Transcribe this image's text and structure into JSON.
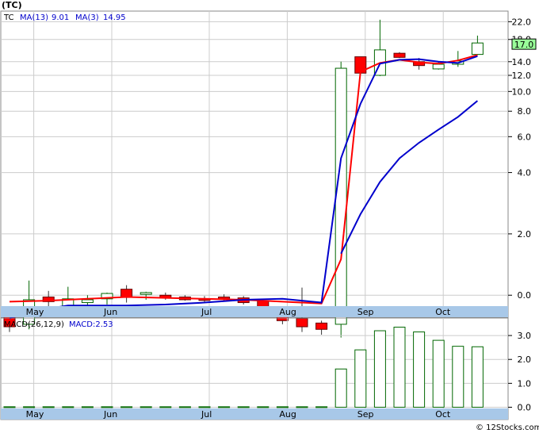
{
  "header": {
    "title": "(TC)",
    "ticker": "TC",
    "ma13_label": "MA(13)",
    "ma13_value": "9.01",
    "ma3_label": "MA(3)",
    "ma3_value": "14.95",
    "macd_label": "MACD(26,12,9)",
    "macd_value_label": "MACD:2.53",
    "watermark": "© 12Stocks.com"
  },
  "colors": {
    "up": "#006600",
    "down": "#ff0000",
    "ma13": "#ff0000",
    "ma3": "#0000cc",
    "axis_bg": "#a8c8e8",
    "grid": "#cccccc",
    "last_price_box": "#99ff99"
  },
  "chart_data": [
    {
      "type": "candlestick",
      "title": "(TC)",
      "yscale": "log",
      "ylim": [
        0.9,
        23.5
      ],
      "price_ticks": [
        {
          "value": 22.0,
          "label": "22.0"
        },
        {
          "value": 18.0,
          "label": "18.0"
        },
        {
          "value": 14.0,
          "label": "14.0"
        },
        {
          "value": 12.0,
          "label": "12.0"
        },
        {
          "value": 10.0,
          "label": "10.0"
        },
        {
          "value": 8.0,
          "label": "8.0"
        },
        {
          "value": 6.0,
          "label": "6.0"
        },
        {
          "value": 4.0,
          "label": "4.0"
        },
        {
          "value": 2.0,
          "label": "2.0"
        },
        {
          "value": 1.0,
          "label": "0.0"
        }
      ],
      "last_price": {
        "value": 17.0,
        "label": "17.0"
      },
      "x_labels": [
        {
          "week": 1,
          "label": "May"
        },
        {
          "week": 5,
          "label": "Jun"
        },
        {
          "week": 10,
          "label": "Jul"
        },
        {
          "week": 14,
          "label": "Aug"
        },
        {
          "week": 18,
          "label": "Sep"
        },
        {
          "week": 22,
          "label": "Oct"
        }
      ],
      "weeks": 24,
      "candles": [
        {
          "week": 0,
          "open": 0.8,
          "high": 0.81,
          "low": 0.66,
          "close": 0.7
        },
        {
          "week": 1,
          "open": 0.72,
          "high": 1.18,
          "low": 0.68,
          "close": 0.95
        },
        {
          "week": 2,
          "open": 0.98,
          "high": 1.05,
          "low": 0.8,
          "close": 0.93
        },
        {
          "week": 3,
          "open": 0.88,
          "high": 1.1,
          "low": 0.8,
          "close": 0.96
        },
        {
          "week": 4,
          "open": 0.92,
          "high": 1.0,
          "low": 0.86,
          "close": 0.95
        },
        {
          "week": 5,
          "open": 0.96,
          "high": 1.03,
          "low": 0.9,
          "close": 1.02
        },
        {
          "week": 6,
          "open": 1.07,
          "high": 1.12,
          "low": 0.92,
          "close": 0.98
        },
        {
          "week": 7,
          "open": 1.01,
          "high": 1.04,
          "low": 0.95,
          "close": 1.03
        },
        {
          "week": 8,
          "open": 1.0,
          "high": 1.03,
          "low": 0.95,
          "close": 0.97
        },
        {
          "week": 9,
          "open": 0.98,
          "high": 1.0,
          "low": 0.94,
          "close": 0.95
        },
        {
          "week": 10,
          "open": 0.96,
          "high": 0.99,
          "low": 0.92,
          "close": 0.95
        },
        {
          "week": 11,
          "open": 0.98,
          "high": 1.01,
          "low": 0.93,
          "close": 0.96
        },
        {
          "week": 12,
          "open": 0.97,
          "high": 0.99,
          "low": 0.9,
          "close": 0.92
        },
        {
          "week": 13,
          "open": 0.94,
          "high": 0.95,
          "low": 0.79,
          "close": 0.81
        },
        {
          "week": 14,
          "open": 0.84,
          "high": 0.87,
          "low": 0.72,
          "close": 0.75
        },
        {
          "week": 15,
          "open": 0.77,
          "high": 1.09,
          "low": 0.66,
          "close": 0.7
        },
        {
          "week": 16,
          "open": 0.73,
          "high": 0.75,
          "low": 0.64,
          "close": 0.68
        },
        {
          "week": 17,
          "open": 0.72,
          "high": 14.0,
          "low": 0.62,
          "close": 13.0
        },
        {
          "week": 18,
          "open": 14.8,
          "high": 14.8,
          "low": 12.3,
          "close": 12.3
        },
        {
          "week": 19,
          "open": 12.0,
          "high": 22.5,
          "low": 11.9,
          "close": 16.0
        },
        {
          "week": 20,
          "open": 15.4,
          "high": 15.6,
          "low": 14.6,
          "close": 14.7
        },
        {
          "week": 21,
          "open": 14.0,
          "high": 14.6,
          "low": 12.8,
          "close": 13.4
        },
        {
          "week": 22,
          "open": 12.9,
          "high": 14.1,
          "low": 12.8,
          "close": 13.6
        },
        {
          "week": 23,
          "open": 13.6,
          "high": 15.8,
          "low": 13.2,
          "close": 14.1
        },
        {
          "week": 24,
          "open": 15.2,
          "high": 18.8,
          "low": 15.1,
          "close": 17.3
        }
      ],
      "series": [
        {
          "name": "MA(13)",
          "color": "#ff0000",
          "points": [
            {
              "week": 0,
              "value": 0.93
            },
            {
              "week": 2,
              "value": 0.94
            },
            {
              "week": 4,
              "value": 0.96
            },
            {
              "week": 6,
              "value": 0.98
            },
            {
              "week": 8,
              "value": 0.97
            },
            {
              "week": 10,
              "value": 0.96
            },
            {
              "week": 12,
              "value": 0.95
            },
            {
              "week": 14,
              "value": 0.93
            },
            {
              "week": 16,
              "value": 0.91
            },
            {
              "week": 17,
              "value": 1.5
            },
            {
              "week": 18,
              "value": 12.5
            },
            {
              "week": 19,
              "value": 13.8
            },
            {
              "week": 20,
              "value": 14.3
            },
            {
              "week": 21,
              "value": 13.9
            },
            {
              "week": 22,
              "value": 13.7
            },
            {
              "week": 23,
              "value": 14.2
            },
            {
              "week": 24,
              "value": 15.1
            }
          ]
        },
        {
          "name": "MA(3)",
          "color": "#0000cc",
          "points": [
            {
              "week": 0,
              "value": 0.77
            },
            {
              "week": 1,
              "value": 0.83
            },
            {
              "week": 2,
              "value": 0.86
            },
            {
              "week": 3,
              "value": 0.89
            },
            {
              "week": 4,
              "value": 0.89
            },
            {
              "week": 6,
              "value": 0.89
            },
            {
              "week": 8,
              "value": 0.9
            },
            {
              "week": 10,
              "value": 0.92
            },
            {
              "week": 12,
              "value": 0.95
            },
            {
              "week": 14,
              "value": 0.96
            },
            {
              "week": 16,
              "value": 0.92
            },
            {
              "week": 17,
              "value": 4.7
            },
            {
              "week": 18,
              "value": 8.7
            },
            {
              "week": 19,
              "value": 13.7
            },
            {
              "week": 20,
              "value": 14.3
            },
            {
              "week": 21,
              "value": 14.4
            },
            {
              "week": 22,
              "value": 14.0
            },
            {
              "week": 23,
              "value": 13.8
            },
            {
              "week": 24,
              "value": 14.9
            }
          ]
        },
        {
          "name": "MA(3)-lower",
          "color": "#0000cc",
          "points": [
            {
              "week": 17,
              "value": 1.6
            },
            {
              "week": 18,
              "value": 2.5
            },
            {
              "week": 19,
              "value": 3.6
            },
            {
              "week": 20,
              "value": 4.7
            },
            {
              "week": 21,
              "value": 5.6
            },
            {
              "week": 22,
              "value": 6.5
            },
            {
              "week": 23,
              "value": 7.5
            },
            {
              "week": 24,
              "value": 9.0
            }
          ]
        }
      ]
    },
    {
      "type": "bar",
      "title": "MACD(26,12,9)",
      "ylim": [
        -0.05,
        3.6
      ],
      "y_ticks": [
        {
          "value": 3.0,
          "label": "3.0"
        },
        {
          "value": 2.0,
          "label": "2.0"
        },
        {
          "value": 1.0,
          "label": "1.0"
        },
        {
          "value": 0.0,
          "label": "0.0"
        }
      ],
      "bars": [
        {
          "week": 0,
          "value": 0.02
        },
        {
          "week": 1,
          "value": 0.02
        },
        {
          "week": 2,
          "value": 0.02
        },
        {
          "week": 3,
          "value": 0.02
        },
        {
          "week": 4,
          "value": 0.02
        },
        {
          "week": 5,
          "value": 0.02
        },
        {
          "week": 6,
          "value": 0.02
        },
        {
          "week": 7,
          "value": 0.02
        },
        {
          "week": 8,
          "value": 0.02
        },
        {
          "week": 9,
          "value": 0.02
        },
        {
          "week": 10,
          "value": 0.02
        },
        {
          "week": 11,
          "value": 0.02
        },
        {
          "week": 12,
          "value": 0.02
        },
        {
          "week": 13,
          "value": 0.02
        },
        {
          "week": 14,
          "value": 0.02
        },
        {
          "week": 15,
          "value": 0.02
        },
        {
          "week": 16,
          "value": 0.02
        },
        {
          "week": 17,
          "value": 1.6
        },
        {
          "week": 18,
          "value": 2.4
        },
        {
          "week": 19,
          "value": 3.2
        },
        {
          "week": 20,
          "value": 3.35
        },
        {
          "week": 21,
          "value": 3.15
        },
        {
          "week": 22,
          "value": 2.8
        },
        {
          "week": 23,
          "value": 2.55
        },
        {
          "week": 24,
          "value": 2.53
        }
      ]
    }
  ]
}
